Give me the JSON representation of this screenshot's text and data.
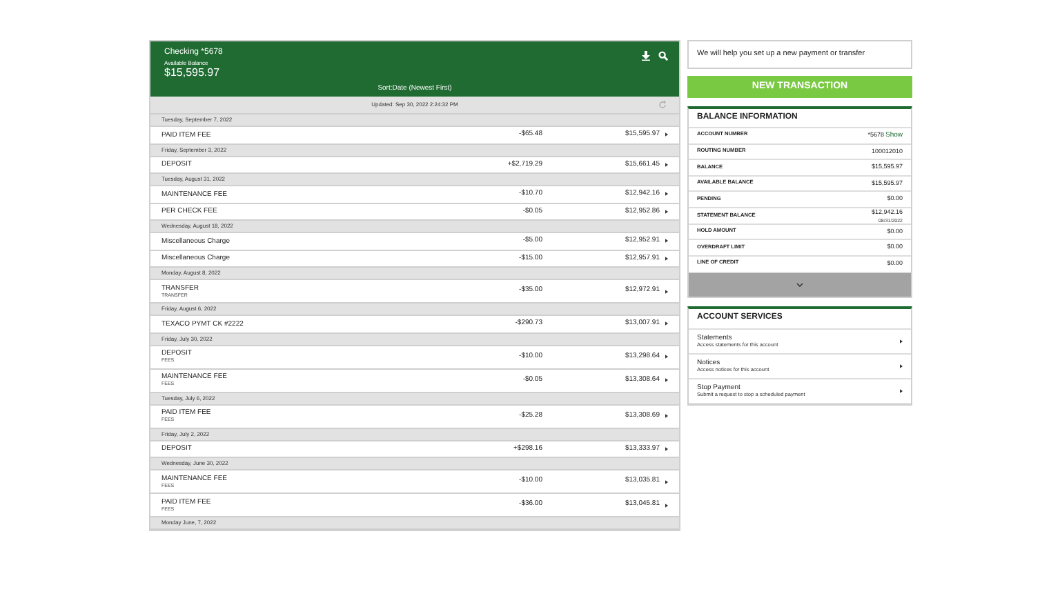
{
  "account": {
    "title": "Checking *5678",
    "balance_label": "Available Balance",
    "balance": "$15,595.97"
  },
  "sort": "Sort:Date (Newest First)",
  "updated": "Updated: Sep 30, 2022 2:24:32 PM",
  "groups": [
    {
      "date": "Tuesday, September 7, 2022",
      "items": [
        {
          "description": "PAID ITEM FEE",
          "amount": "-$65.48",
          "balance": "$15,595.97"
        }
      ]
    },
    {
      "date": "Friday, September 3, 2022",
      "items": [
        {
          "description": "DEPOSIT",
          "amount": "+$2,719.29",
          "balance": "$15,661.45"
        }
      ]
    },
    {
      "date": "Tuesday, August 31, 2022",
      "items": [
        {
          "description": "MAINTENANCE FEE",
          "amount": "-$10.70",
          "balance": "$12,942.16"
        },
        {
          "description": "PER CHECK FEE",
          "amount": "-$0.05",
          "balance": "$12,952.86"
        }
      ]
    },
    {
      "date": "Wednesday, August 18, 2022",
      "items": [
        {
          "description": "Miscellaneous Charge",
          "amount": "-$5.00",
          "balance": "$12,952.91"
        },
        {
          "description": "Miscellaneous Charge",
          "amount": "-$15.00",
          "balance": "$12,957.91"
        }
      ]
    },
    {
      "date": "Monday, August 8, 2022",
      "items": [
        {
          "description": "TRANSFER",
          "category": "TRANSFER",
          "amount": "-$35.00",
          "balance": "$12,972.91"
        }
      ]
    },
    {
      "date": "Friday, August 6, 2022",
      "items": [
        {
          "description": "TEXACO PYMT CK #2222",
          "amount": "-$290.73",
          "balance": "$13,007.91"
        }
      ]
    },
    {
      "date": "Friday, July 30, 2022",
      "items": [
        {
          "description": "DEPOSIT",
          "category": "FEES",
          "amount": "-$10.00",
          "balance": "$13,298.64"
        },
        {
          "description": "MAINTENANCE FEE",
          "category": "FEES",
          "amount": "-$0.05",
          "balance": "$13,308.64"
        }
      ]
    },
    {
      "date": "Tuesday, July 6, 2022",
      "items": [
        {
          "description": "PAID ITEM FEE",
          "category": "FEES",
          "amount": "-$25.28",
          "balance": "$13,308.69"
        }
      ]
    },
    {
      "date": "Friday, July 2, 2022",
      "items": [
        {
          "description": "DEPOSIT",
          "amount": "+$298.16",
          "balance": "$13,333.97"
        }
      ]
    },
    {
      "date": "Wednesday, June 30, 2022",
      "items": [
        {
          "description": "MAINTENANCE FEE",
          "category": "FEES",
          "amount": "-$10.00",
          "balance": "$13,035.81"
        },
        {
          "description": "PAID ITEM FEE",
          "category": "FEES",
          "amount": "-$36.00",
          "balance": "$13,045.81"
        }
      ]
    },
    {
      "date": "Monday June, 7, 2022"
    }
  ],
  "help_text": "We will help you set up a new payment or transfer",
  "new_transaction": "NEW TRANSACTION",
  "balance_info": {
    "title": "BALANCE INFORMATION",
    "rows": [
      {
        "label": "ACCOUNT NUMBER",
        "value": "*5678",
        "link": "Show"
      },
      {
        "label": "ROUTING NUMBER",
        "value": "100012010"
      },
      {
        "label": "BALANCE",
        "value": "$15,595.97"
      },
      {
        "label": "AVAILABLE BALANCE",
        "value": "$15,595.97"
      },
      {
        "label": "PENDING",
        "value": "$0.00"
      },
      {
        "label": "STATEMENT BALANCE",
        "value": "$12,942.16",
        "note": "08/31/2022"
      },
      {
        "label": "HOLD AMOUNT",
        "value": "$0.00"
      },
      {
        "label": "OVERDRAFT LIMIT",
        "value": "$0.00"
      },
      {
        "label": "LINE OF CREDIT",
        "value": "$0.00"
      }
    ]
  },
  "services": {
    "title": "ACCOUNT SERVICES",
    "items": [
      {
        "title": "Statements",
        "subtitle": "Access statements for this account"
      },
      {
        "title": "Notices",
        "subtitle": "Access notices for this account"
      },
      {
        "title": "Stop Payment",
        "subtitle": "Submit a request to stop a scheduled payment"
      }
    ]
  }
}
